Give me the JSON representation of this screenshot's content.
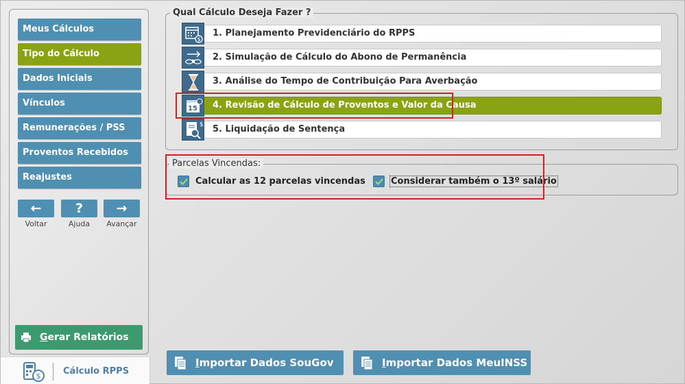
{
  "sidebar": {
    "items": [
      {
        "label": "Meus Cálculos"
      },
      {
        "label": "Tipo do Cálculo"
      },
      {
        "label": "Dados Iniciais"
      },
      {
        "label": "Vínculos"
      },
      {
        "label": "Remunerações / PSS"
      },
      {
        "label": "Proventos Recebidos"
      },
      {
        "label": "Reajustes"
      }
    ],
    "nav": {
      "back_label": "Voltar",
      "help_label": "Ajuda",
      "forward_label": "Avançar",
      "back_icon": "←",
      "help_icon": "?",
      "forward_icon": "→"
    },
    "report_button": {
      "first_letter": "G",
      "rest": "erar Relatórios"
    },
    "brand": {
      "name": "Cálculo RPPS"
    }
  },
  "calc_type": {
    "legend": "Qual Cálculo Deseja Fazer ?",
    "options": [
      {
        "label": "1. Planejamento Previdenciário do RPPS",
        "icon": "calendar-money-icon"
      },
      {
        "label": "2. Simulação de Cálculo do Abono de Permanência",
        "icon": "coins-arrow-icon"
      },
      {
        "label": "3. Análise do Tempo de Contribuição Para Averbação",
        "icon": "hourglass-icon"
      },
      {
        "label": "4. Revisão de Cálculo de Proventos e Valor da Causa",
        "icon": "calendar-15-icon"
      },
      {
        "label": "5. Liquidação de Sentença",
        "icon": "document-search-icon"
      }
    ],
    "selected_index": 3
  },
  "parcelas": {
    "legend": "Parcelas Vincendas:",
    "checks": [
      {
        "label": "Calcular as 12 parcelas vincendas",
        "checked": true
      },
      {
        "label": "Considerar também o 13º salário",
        "checked": true
      }
    ]
  },
  "imports": {
    "sougov": {
      "first_letter": "I",
      "rest": "mportar Dados SouGov"
    },
    "meuinss": {
      "first_letter": "I",
      "rest": "mportar Dados MeuINSS"
    }
  },
  "colors": {
    "accent_blue": "#4f8fb1",
    "accent_green": "#8aa315",
    "report_green": "#3c9a6e",
    "highlight_red": "#d71e1e"
  }
}
